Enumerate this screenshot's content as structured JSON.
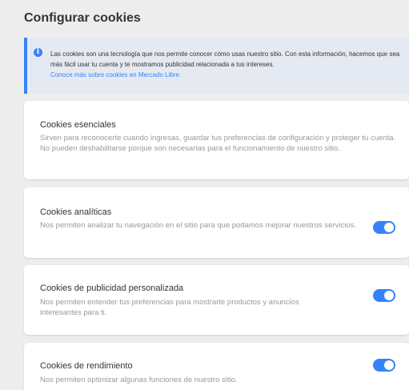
{
  "header": {
    "title": "Configurar cookies"
  },
  "info": {
    "icon": "info-icon",
    "icon_glyph": "i",
    "text": "Las cookies son una tecnología que nos permite conocer cómo usas nuestro sitio. Con esta información, hacemos que sea más fácil usar tu cuenta y te mostramos publicidad relacionada a tus intereses.",
    "link": "Conoce más sobre cookies en Mercado Libre."
  },
  "cards": [
    {
      "title": "Cookies esenciales",
      "description": "Sirven para reconocerte cuando ingresas, guardar tus preferencias de configuración y proteger tu cuenta. No pueden deshabilitarse porque son necesarias para el funcionamiento de nuestro sitio."
    },
    {
      "title": "Cookies analíticas",
      "description": "Nos permiten analizar tu navegación en el sitio para que podamos mejorar nuestros servicios.",
      "enabled": true
    },
    {
      "title": "Cookies de publicidad personalizada",
      "description": "Nos permiten entender tus preferencias para mostrarte productos y anuncios interesantes para ti.",
      "enabled": true
    },
    {
      "title": "Cookies de rendimiento",
      "description": "Nos permiten optimizar algunas funciones de nuestro sitio.",
      "enabled": true
    }
  ],
  "colors": {
    "accent": "#3483fa",
    "background": "#ededed",
    "info_background": "#e5eaf2",
    "card": "#ffffff",
    "title_text": "#333333",
    "description_text": "#999999"
  }
}
